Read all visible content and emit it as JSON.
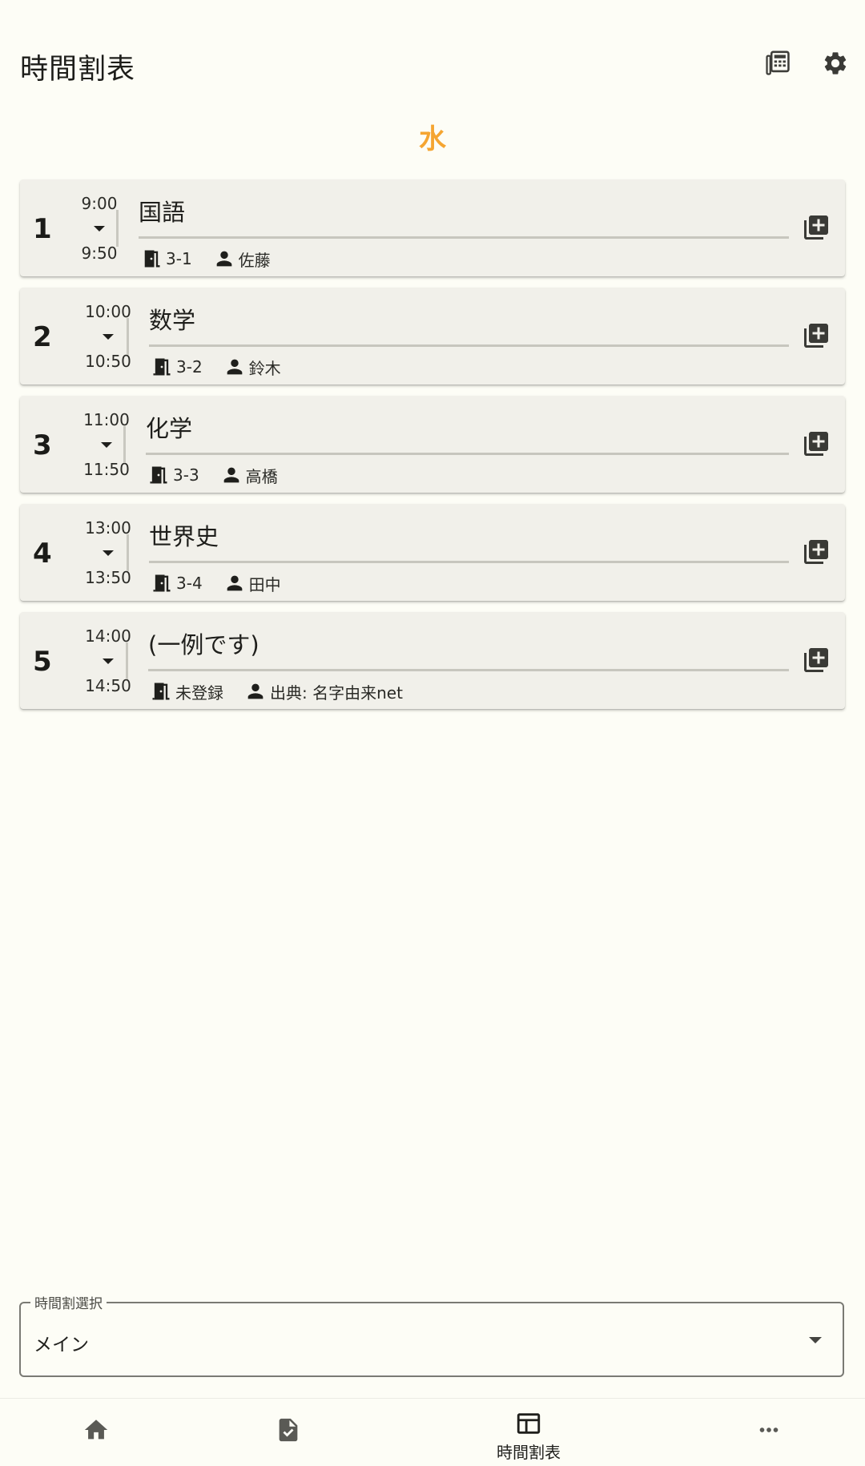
{
  "appbar": {
    "title": "時間割表"
  },
  "day": "水",
  "periods": [
    {
      "number": "1",
      "start": "9:00",
      "end": "9:50",
      "subject": "国語",
      "room": "3-1",
      "teacher": "佐藤"
    },
    {
      "number": "2",
      "start": "10:00",
      "end": "10:50",
      "subject": "数学",
      "room": "3-2",
      "teacher": "鈴木"
    },
    {
      "number": "3",
      "start": "11:00",
      "end": "11:50",
      "subject": "化学",
      "room": "3-3",
      "teacher": "高橋"
    },
    {
      "number": "4",
      "start": "13:00",
      "end": "13:50",
      "subject": "世界史",
      "room": "3-4",
      "teacher": "田中"
    },
    {
      "number": "5",
      "start": "14:00",
      "end": "14:50",
      "subject": "(一例です)",
      "room": "未登録",
      "teacher": "出典: 名字由来net"
    }
  ],
  "selector": {
    "label": "時間割選択",
    "value": "メイン"
  },
  "nav": {
    "items": [
      {
        "icon": "home-icon",
        "label": ""
      },
      {
        "icon": "task-icon",
        "label": ""
      },
      {
        "icon": "timetable-icon",
        "label": "時間割表"
      },
      {
        "icon": "more-icon",
        "label": ""
      }
    ],
    "active_index": 2
  },
  "colors": {
    "accent": "#f5a531",
    "background": "#fdfdf6",
    "card": "#f1f0ea"
  }
}
